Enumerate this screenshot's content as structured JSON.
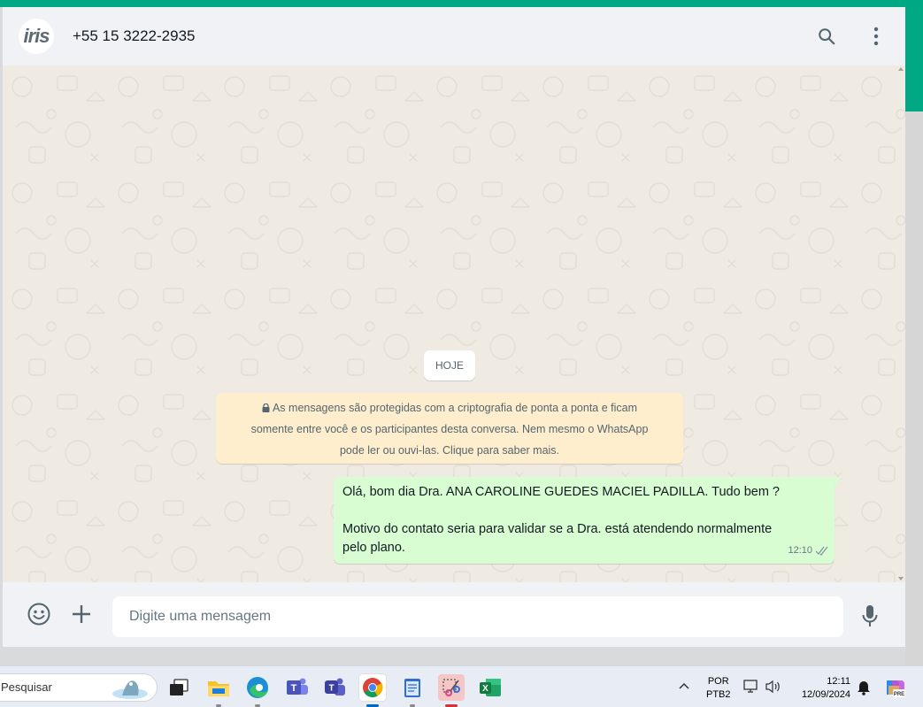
{
  "header": {
    "avatar_text": "iris",
    "contact": "+55 15 3222-2935"
  },
  "chat": {
    "date_chip": "HOJE",
    "encryption_notice_line1": "As mensagens são protegidas com a criptografia de ponta a ponta e ficam",
    "encryption_notice_line2": "somente entre você e os participantes desta conversa. Nem mesmo o WhatsApp",
    "encryption_notice_line3": "pode ler ou ouvi-las. Clique para saber mais.",
    "message": {
      "line1": "Olá, bom dia Dra. ANA CAROLINE GUEDES MACIEL PADILLA. Tudo bem ?",
      "line2": "Motivo do contato seria para validar se a Dra. está atendendo normalmente",
      "line3": "pelo plano.",
      "time": "12:10",
      "status_icon": "double-check-icon"
    }
  },
  "composer": {
    "placeholder": "Digite uma mensagem",
    "icons": [
      "emoji-icon",
      "plus-icon",
      "microphone-icon"
    ]
  },
  "taskbar": {
    "search_placeholder": "Pesquisar",
    "apps": [
      "task-view-icon",
      "file-explorer-icon",
      "edge-icon",
      "teams-icon",
      "teams-new-icon",
      "chrome-icon",
      "notepad-icon",
      "snipping-tool-icon",
      "excel-icon"
    ],
    "language_line1": "POR",
    "language_line2": "PTB2",
    "time": "12:11",
    "date": "12/09/2024"
  },
  "colors": {
    "accent": "#00a884",
    "chat_bg": "#efeae2",
    "outgoing_bubble": "#d9fdd3",
    "system_notice": "#ffeecd"
  }
}
